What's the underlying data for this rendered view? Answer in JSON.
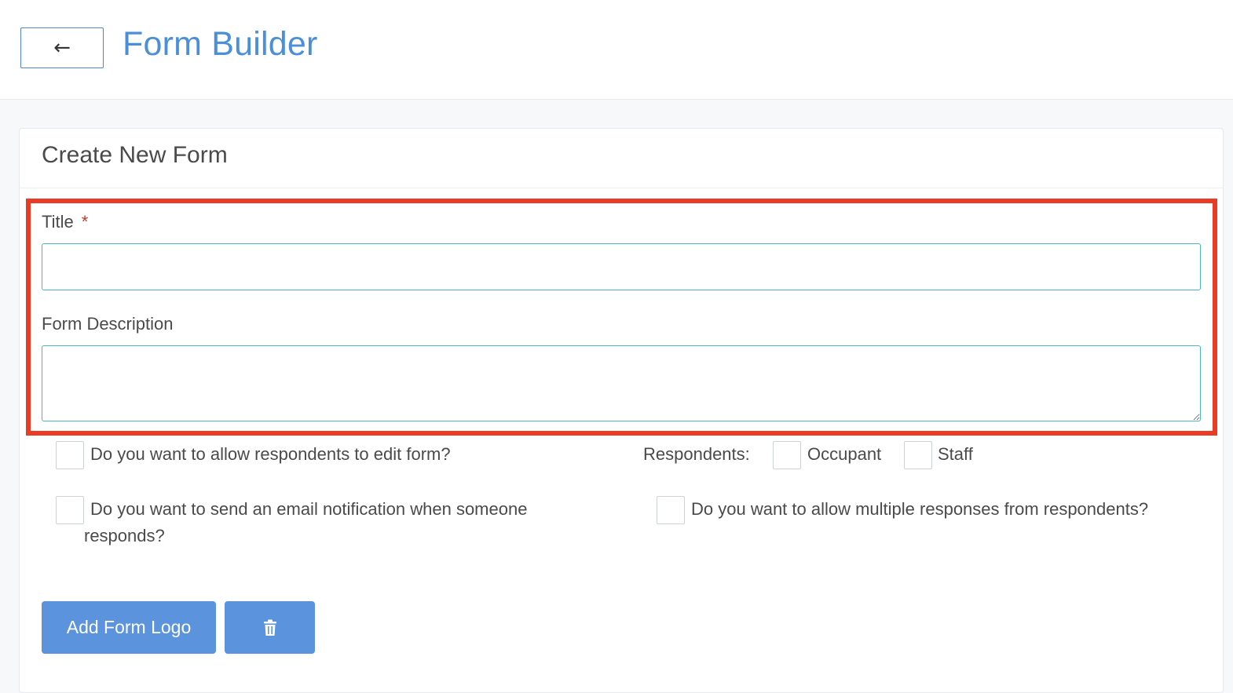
{
  "header": {
    "back_icon": "←",
    "title": "Form Builder"
  },
  "card": {
    "title": "Create New Form",
    "title_field": {
      "label": "Title",
      "required_mark": "*",
      "value": ""
    },
    "description_field": {
      "label": "Form Description",
      "value": ""
    },
    "options": {
      "allow_edit": "Do you want to allow respondents to edit form?",
      "respondents_label": "Respondents:",
      "respondent_occupant": "Occupant",
      "respondent_staff": "Staff",
      "email_notify_line1": "Do you want to send an email notification when someone",
      "email_notify_line2": "responds?",
      "multiple_responses": "Do you want to allow multiple responses from respondents?"
    },
    "buttons": {
      "add_logo": "Add Form Logo",
      "delete_icon": "trash-icon"
    }
  },
  "colors": {
    "accent": "#4a8fd8",
    "button": "#5b93dc",
    "highlight": "#ea3b24",
    "input_border": "#4ab5c4"
  }
}
